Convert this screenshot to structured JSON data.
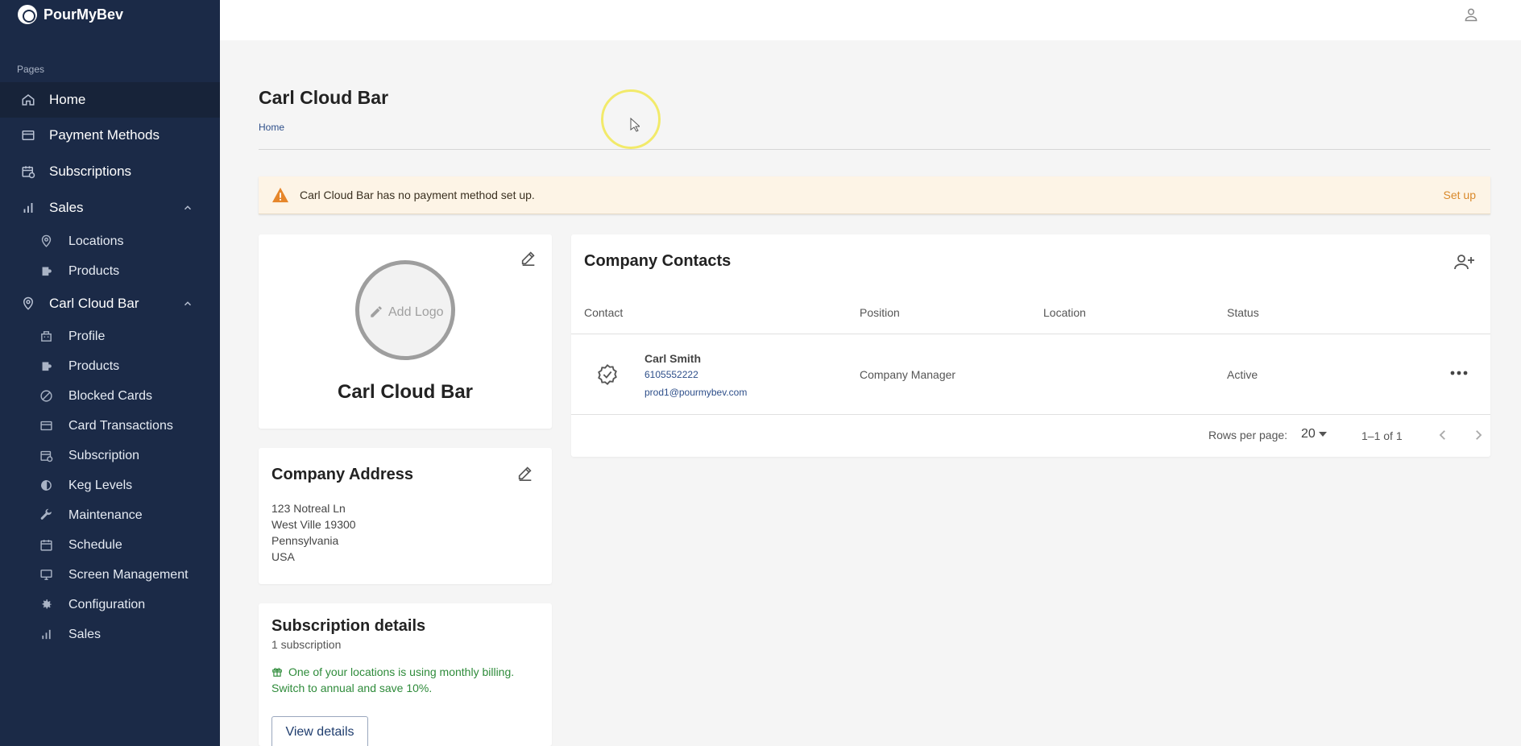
{
  "app": {
    "brand": "PourMyBev"
  },
  "sidebar": {
    "section_label": "Pages",
    "items": [
      {
        "label": "Home",
        "icon": "home-icon"
      },
      {
        "label": "Payment Methods",
        "icon": "credit-card-icon"
      },
      {
        "label": "Subscriptions",
        "icon": "calendar-sync-icon"
      },
      {
        "label": "Sales",
        "icon": "bar-chart-icon"
      },
      {
        "label": "Carl Cloud Bar",
        "icon": "location-pin-icon"
      }
    ],
    "sales_subitems": [
      {
        "label": "Locations",
        "icon": "location-pin-icon"
      },
      {
        "label": "Products",
        "icon": "beer-keg-icon"
      }
    ],
    "bar_subitems": [
      {
        "label": "Profile",
        "icon": "building-icon"
      },
      {
        "label": "Products",
        "icon": "beer-keg-icon"
      },
      {
        "label": "Blocked Cards",
        "icon": "block-icon"
      },
      {
        "label": "Card Transactions",
        "icon": "credit-card-icon"
      },
      {
        "label": "Subscription",
        "icon": "calendar-sync-icon"
      },
      {
        "label": "Keg Levels",
        "icon": "contrast-icon"
      },
      {
        "label": "Maintenance",
        "icon": "wrench-icon"
      },
      {
        "label": "Schedule",
        "icon": "calendar-icon"
      },
      {
        "label": "Screen Management",
        "icon": "monitor-icon"
      },
      {
        "label": "Configuration",
        "icon": "gear-icon"
      },
      {
        "label": "Sales",
        "icon": "bar-chart-icon"
      }
    ]
  },
  "header": {
    "title": "Carl Cloud Bar",
    "breadcrumb": "Home"
  },
  "alert": {
    "message": "Carl Cloud Bar has no payment method set up.",
    "action": "Set up",
    "color": "#e6862a"
  },
  "profile_card": {
    "add_logo": "Add Logo",
    "company_name": "Carl Cloud Bar"
  },
  "address_card": {
    "title": "Company Address",
    "lines": [
      "123 Notreal Ln",
      "West Ville 19300",
      "Pennsylvania",
      "USA"
    ]
  },
  "subscription_card": {
    "title": "Subscription details",
    "count": "1 subscription",
    "promo_line1": "One of your locations is using monthly billing.",
    "promo_line2": "Switch to annual and save 10%.",
    "button": "View details"
  },
  "contacts": {
    "title": "Company Contacts",
    "columns": [
      "Contact",
      "Position",
      "Location",
      "Status"
    ],
    "rows": [
      {
        "name": "Carl Smith",
        "phone": "6105552222",
        "email": "prod1@pourmybev.com",
        "position": "Company Manager",
        "location": "",
        "status": "Active"
      }
    ],
    "pagination": {
      "rows_per_page_label": "Rows per page:",
      "rows_per_page": "20",
      "range": "1–1 of 1"
    }
  },
  "colors": {
    "sidebar_bg": "#1b2a47",
    "accent_link": "#2e4f8a",
    "alert_bg": "#fdf4e6",
    "promo_green": "#2e8b3a"
  }
}
